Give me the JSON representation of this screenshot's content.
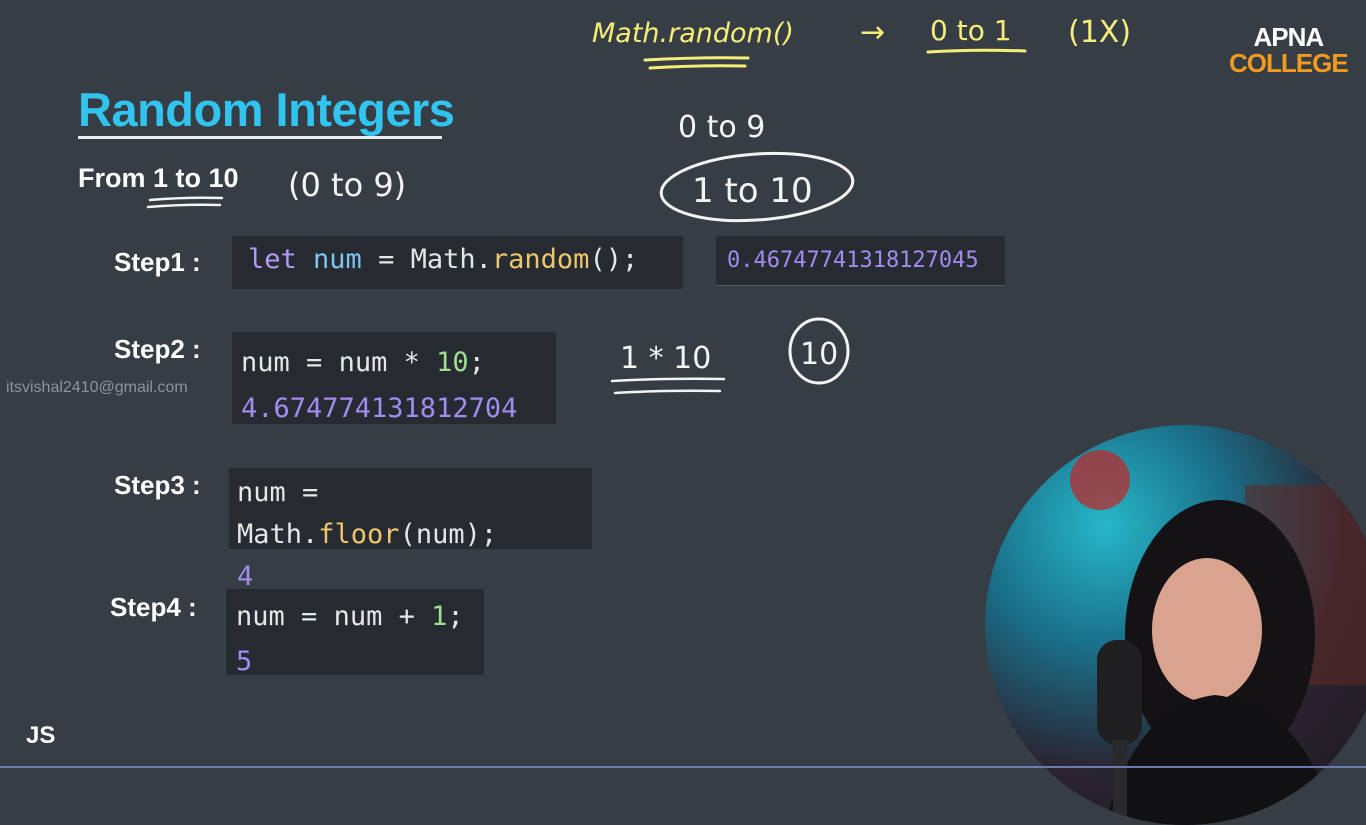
{
  "title": "Random Integers",
  "subtitle": {
    "prefix": "From ",
    "range": "1 to 10"
  },
  "steps": [
    {
      "label": "Step1 :",
      "code": [
        "let",
        "num",
        "=",
        "Math.",
        "random",
        "();"
      ],
      "output": "0.46747741318127045"
    },
    {
      "label": "Step2 :",
      "code": [
        "num",
        "=",
        "num",
        "*",
        "10",
        ";"
      ],
      "output": "4.674774131812704"
    },
    {
      "label": "Step3 :",
      "code": [
        "num",
        "=",
        "Math.",
        "floor",
        "(num);"
      ],
      "output": "4"
    },
    {
      "label": "Step4 :",
      "code": [
        "num",
        "=",
        "num",
        "+",
        "1",
        ";"
      ],
      "output": "5"
    }
  ],
  "watermark_email": "itsvishal2410@gmail.com",
  "footer_tag": "JS",
  "logo": {
    "line1": "APNA",
    "line2": "COLLEGE"
  },
  "annotations": {
    "top_expr": "Math.random()",
    "top_arrow": "→",
    "top_range": "0 to 1",
    "top_mult": "(1X)",
    "mid_range_a": "0 to 9",
    "mid_range_b": "1 to 10",
    "paren_range": "(0 to 9)",
    "calc": "1 * 10",
    "circled": "10"
  },
  "colors": {
    "background": "#373d45",
    "title": "#31c4ee",
    "handwriting_yellow": "#f4ee79",
    "handwriting_white": "#f4f4f4",
    "code_bg": "#262a31",
    "logo_orange": "#f29a1f"
  }
}
